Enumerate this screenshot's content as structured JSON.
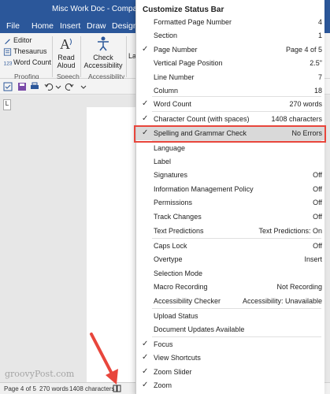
{
  "window": {
    "title": "Misc Work Doc  -  Compatibility"
  },
  "menu": [
    "File",
    "Home",
    "Insert",
    "Draw",
    "Design"
  ],
  "ribbon": {
    "proofing": {
      "editor": "Editor",
      "thesaurus": "Thesaurus",
      "word_count": "Word Count",
      "label": "Proofing"
    },
    "speech": {
      "read_aloud": [
        "Read",
        "Aloud"
      ],
      "label": "Speech"
    },
    "accessibility": {
      "check": [
        "Check",
        "Accessibility"
      ],
      "label": "Accessibility"
    },
    "cut_off_label": "La"
  },
  "ruler_marker": "L",
  "status_bar": {
    "page": "Page 4 of 5",
    "words": "270 words",
    "characters": "1408 characters"
  },
  "watermark": "groovyPost.com",
  "context_menu": {
    "title": "Customize Status Bar",
    "items": [
      {
        "checked": false,
        "label": "Formatted Page Number",
        "value": "4"
      },
      {
        "checked": false,
        "label": "Section",
        "value": "1"
      },
      {
        "checked": true,
        "label": "Page Number",
        "value": "Page 4 of 5"
      },
      {
        "checked": false,
        "label": "Vertical Page Position",
        "value": "2.5\""
      },
      {
        "checked": false,
        "label": "Line Number",
        "value": "7"
      },
      {
        "checked": false,
        "label": "Column",
        "value": "18"
      },
      {
        "checked": true,
        "label": "Word Count",
        "value": "270 words"
      },
      {
        "checked": true,
        "label": "Character Count (with spaces)",
        "value": "1408 characters"
      },
      {
        "checked": true,
        "label": "Spelling and Grammar Check",
        "value": "No Errors",
        "highlighted": true
      },
      {
        "checked": false,
        "label": "Language",
        "value": ""
      },
      {
        "checked": false,
        "label": "Label",
        "value": ""
      },
      {
        "checked": false,
        "label": "Signatures",
        "value": "Off"
      },
      {
        "checked": false,
        "label": "Information Management Policy",
        "value": "Off"
      },
      {
        "checked": false,
        "label": "Permissions",
        "value": "Off"
      },
      {
        "checked": false,
        "label": "Track Changes",
        "value": "Off"
      },
      {
        "checked": false,
        "label": "Text Predictions",
        "value": "Text Predictions: On"
      },
      {
        "checked": false,
        "label": "Caps Lock",
        "value": "Off"
      },
      {
        "checked": false,
        "label": "Overtype",
        "value": "Insert"
      },
      {
        "checked": false,
        "label": "Selection Mode",
        "value": ""
      },
      {
        "checked": false,
        "label": "Macro Recording",
        "value": "Not Recording"
      },
      {
        "checked": false,
        "label": "Accessibility Checker",
        "value": "Accessibility: Unavailable"
      },
      {
        "checked": false,
        "label": "Upload Status",
        "value": ""
      },
      {
        "checked": false,
        "label": "Document Updates Available",
        "value": ""
      },
      {
        "checked": true,
        "label": "Focus",
        "value": ""
      },
      {
        "checked": true,
        "label": "View Shortcuts",
        "value": ""
      },
      {
        "checked": true,
        "label": "Zoom Slider",
        "value": ""
      },
      {
        "checked": true,
        "label": "Zoom",
        "value": ""
      }
    ]
  },
  "colors": {
    "title_bar": "#2b579a",
    "highlight_border": "#e8463c",
    "arrow": "#e8463c"
  }
}
